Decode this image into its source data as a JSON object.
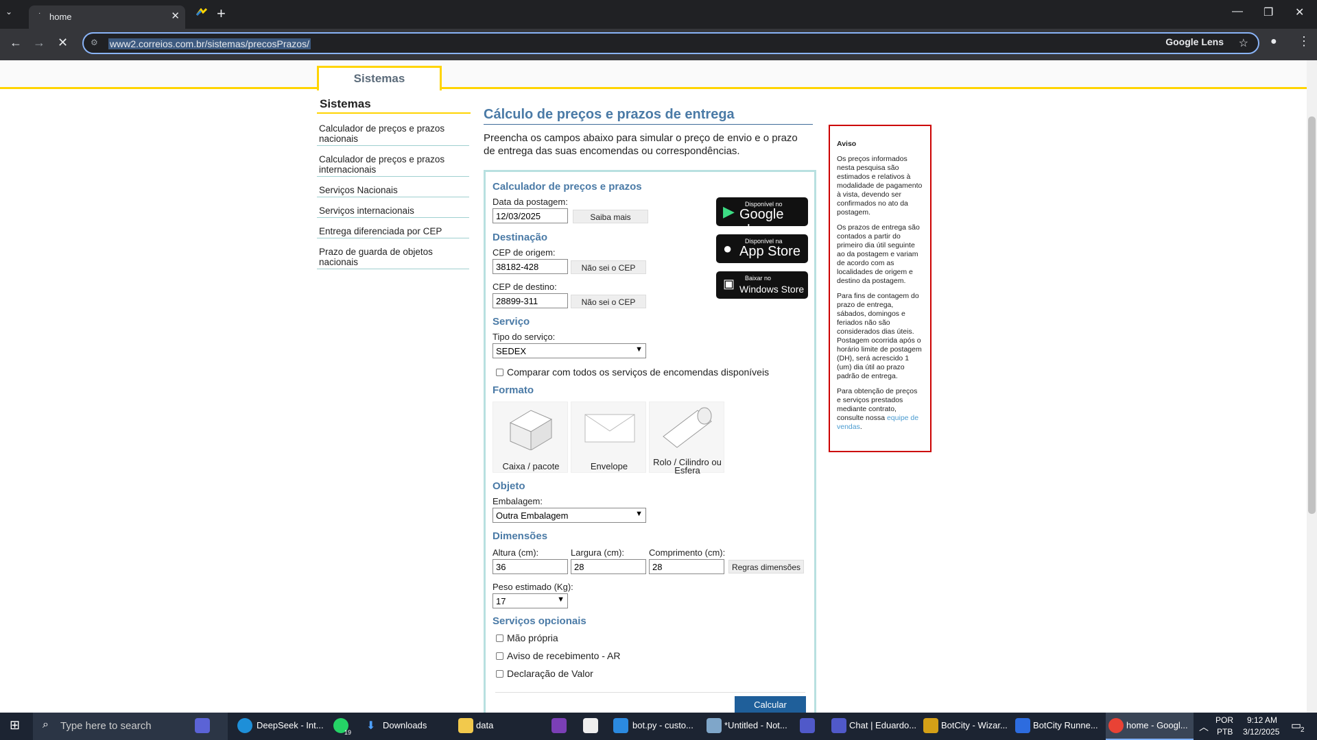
{
  "browser": {
    "tab_title": "home",
    "url": "www2.correios.com.br/sistemas/precosPrazos/",
    "lens_label": "Google Lens"
  },
  "topnav": {
    "tab_label": "Sistemas"
  },
  "sidebar": {
    "title": "Sistemas",
    "items": [
      "Calculador de preços e prazos nacionais",
      "Calculador de preços e prazos internacionais",
      "Serviços Nacionais",
      "Serviços internacionais",
      "Entrega diferenciada por CEP",
      "Prazo de guarda de objetos nacionais"
    ]
  },
  "main": {
    "title": "Cálculo de preços e prazos de entrega",
    "intro": "Preencha os campos abaixo para simular o preço de envio e o prazo de entrega das suas encomendas ou correspondências."
  },
  "form": {
    "section_calc": "Calculador de preços e prazos",
    "date_label": "Data da postagem:",
    "date_value": "12/03/2025",
    "saiba_mais": "Saiba mais",
    "section_dest": "Destinação",
    "origem_label": "CEP de origem:",
    "origem_value": "38182-428",
    "nao_sei_cep": "Não sei o CEP",
    "destino_label": "CEP de destino:",
    "destino_value": "28899-311",
    "section_servico": "Serviço",
    "tipo_label": "Tipo do serviço:",
    "tipo_value": "SEDEX",
    "comparar_label": "Comparar com todos os serviços de encomendas disponíveis",
    "section_formato": "Formato",
    "formatos": [
      "Caixa / pacote",
      "Envelope",
      "Rolo / Cilindro ou Esfera"
    ],
    "section_objeto": "Objeto",
    "embalagem_label": "Embalagem:",
    "embalagem_value": "Outra Embalagem",
    "section_dim": "Dimensões",
    "altura_label": "Altura (cm):",
    "altura_value": "36",
    "largura_label": "Largura (cm):",
    "largura_value": "28",
    "comprimento_label": "Comprimento (cm):",
    "comprimento_value": "28",
    "regras_label": "Regras dimensões",
    "peso_label": "Peso estimado (Kg):",
    "peso_value": "17",
    "section_opc": "Serviços opcionais",
    "opcionais": [
      "Mão própria",
      "Aviso de recebimento - AR",
      "Declaração de Valor"
    ],
    "calcular": "Calcular"
  },
  "stores": {
    "gp_small": "Disponível no",
    "gp_big": "Google play",
    "as_small": "Disponível na",
    "as_big": "App Store",
    "ws_small": "Baixar no",
    "ws_big": "Windows Store"
  },
  "aviso": {
    "title": "Aviso",
    "p1": "Os preços informados nesta pesquisa são estimados e relativos à modalidade de pagamento à vista, devendo ser confirmados no ato da postagem.",
    "p2": "Os prazos de entrega são contados a partir do primeiro dia útil seguinte ao da postagem e variam de acordo com as localidades de origem e destino da postagem.",
    "p3": "Para fins de contagem do prazo de entrega, sábados, domingos e feriados não são considerados dias úteis. Postagem ocorrida após o horário limite de postagem (DH), será acrescido 1 (um) dia útil ao prazo padrão de entrega.",
    "p4": "Para obtenção de preços e serviços prestados mediante contrato, consulte nossa",
    "p4_link": "equipe de vendas",
    "p4_end": "."
  },
  "taskbar": {
    "search": "Type here to search",
    "items": [
      "DeepSeek - Int...",
      "Downloads",
      "data",
      "bot.py - custo...",
      "*Untitled - Not...",
      "Chat | Eduardo...",
      "BotCity - Wizar...",
      "BotCity Runne...",
      "home - Googl..."
    ],
    "lang1": "POR",
    "lang2": "PTB",
    "time": "9:12 AM",
    "date": "3/12/2025",
    "whatsapp_badge": "19",
    "notif": "2"
  }
}
